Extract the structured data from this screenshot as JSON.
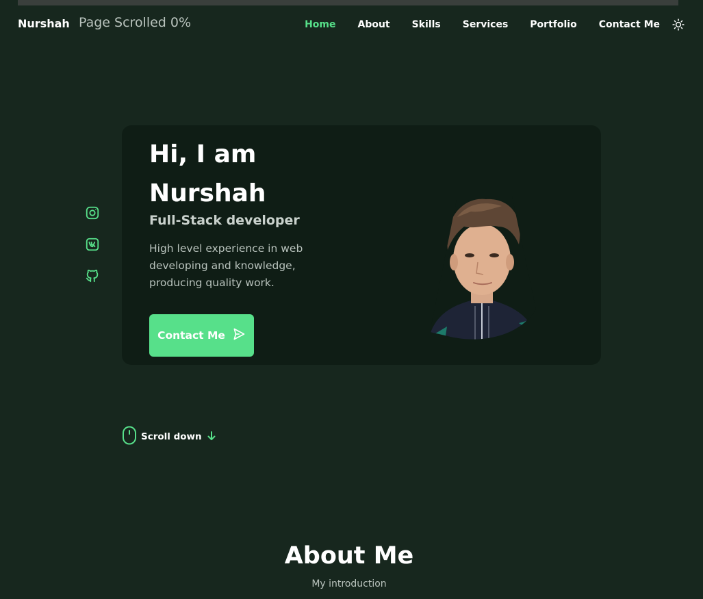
{
  "scroll_progress": {
    "percent": 0
  },
  "header": {
    "logo": "Nurshah",
    "scroll_status": "Page Scrolled 0%",
    "nav": [
      {
        "label": "Home",
        "active": true
      },
      {
        "label": "About"
      },
      {
        "label": "Skills"
      },
      {
        "label": "Services"
      },
      {
        "label": "Portfolio"
      },
      {
        "label": "Contact Me"
      }
    ],
    "theme_icon": "sun-icon"
  },
  "socials": [
    "instagram-icon",
    "vk-icon",
    "github-icon"
  ],
  "hero": {
    "title": "Hi, I am Nurshah",
    "subtitle": "Full-Stack developer",
    "description": "High level experience in web developing and knowledge, producing quality work.",
    "button_label": "Contact Me",
    "button_icon": "send-icon",
    "photo": "profile-photo"
  },
  "scroll_down": {
    "label": "Scroll down",
    "icon": "mouse-icon"
  },
  "about": {
    "title": "About Me",
    "subtitle": "My introduction"
  },
  "colors": {
    "background": "#17271e",
    "card": "#0f1d15",
    "accent": "#57e08a",
    "text": "#ffffff",
    "muted": "#b9c3bd"
  }
}
